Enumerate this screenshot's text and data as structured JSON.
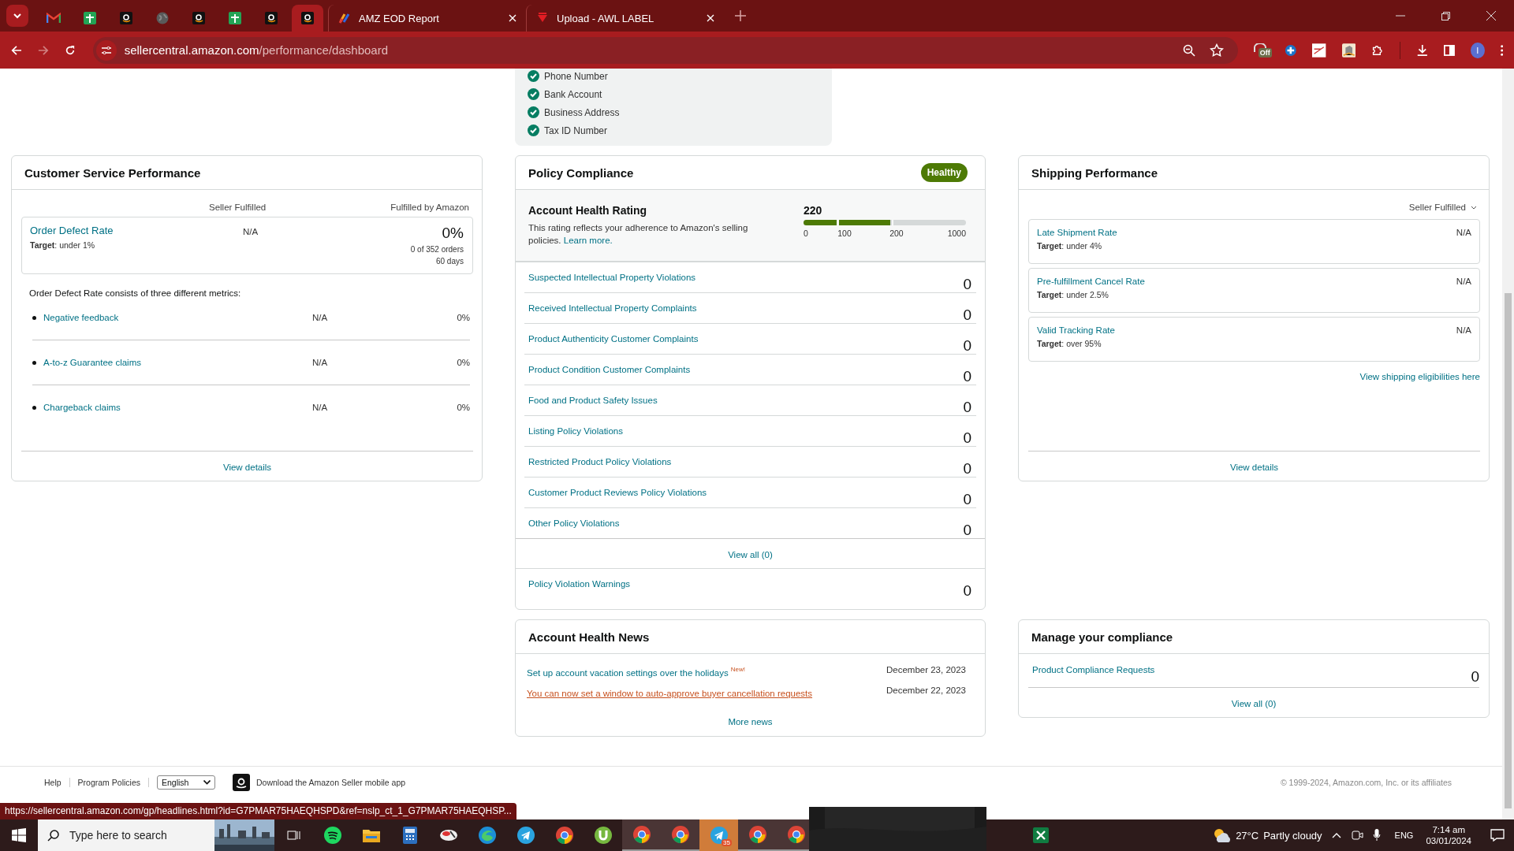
{
  "browser": {
    "pinned_tabs": [
      {
        "selected": false
      },
      {
        "selected": false
      },
      {
        "selected": false
      },
      {
        "selected": false
      },
      {
        "selected": false
      },
      {
        "selected": false
      },
      {
        "selected": false
      },
      {
        "selected": true
      }
    ],
    "tabs": [
      {
        "title": "AMZ EOD Report",
        "selected": false
      },
      {
        "title": "Upload - AWL LABEL",
        "selected": false
      }
    ],
    "url_host": "sellercentral.amazon.com",
    "url_path": "/performance/dashboard",
    "extension_badge": "Off",
    "profile_initial": "I"
  },
  "verification": {
    "items": [
      {
        "label": "Phone Number",
        "verified": true
      },
      {
        "label": "Bank Account",
        "verified": true
      },
      {
        "label": "Business Address",
        "verified": true
      },
      {
        "label": "Tax ID Number",
        "verified": true
      }
    ]
  },
  "customer_service": {
    "title": "Customer Service Performance",
    "columns": [
      "Seller Fulfilled",
      "Fulfilled by Amazon"
    ],
    "odr": {
      "name": "Order Defect Rate",
      "target": "**Target**: under 1%",
      "seller": "N/A",
      "fba": "0%",
      "fba_detail": "0 of 352 orders",
      "period": "60 days"
    },
    "note": "Order Defect Rate consists of three different metrics:",
    "metrics": [
      {
        "name": "Negative feedback",
        "seller": "N/A",
        "fba": "0%"
      },
      {
        "name": "A-to-z Guarantee claims",
        "seller": "N/A",
        "fba": "0%"
      },
      {
        "name": "Chargeback claims",
        "seller": "N/A",
        "fba": "0%"
      }
    ],
    "view": "View details"
  },
  "policy": {
    "title": "Policy Compliance",
    "status": "Healthy",
    "rating": {
      "title": "Account Health Rating",
      "description": "This rating reflects your adherence to Amazon's selling policies.",
      "link": "Learn more.",
      "score": "220",
      "level": 0.535,
      "ticks": [
        "0",
        "100",
        "200",
        "1000"
      ]
    },
    "violations": [
      {
        "label": "Suspected Intellectual Property Violations",
        "count": "0"
      },
      {
        "label": "Received Intellectual Property Complaints",
        "count": "0"
      },
      {
        "label": "Product Authenticity Customer Complaints",
        "count": "0"
      },
      {
        "label": "Product Condition Customer Complaints",
        "count": "0"
      },
      {
        "label": "Food and Product Safety Issues",
        "count": "0"
      },
      {
        "label": "Listing Policy Violations",
        "count": "0"
      },
      {
        "label": "Restricted Product Policy Violations",
        "count": "0"
      },
      {
        "label": "Customer Product Reviews Policy Violations",
        "count": "0"
      },
      {
        "label": "Other Policy Violations",
        "count": "0"
      }
    ],
    "view_all": "View all (0)",
    "warnings": {
      "label": "Policy Violation Warnings",
      "count": "0"
    }
  },
  "news": {
    "title": "Account Health News",
    "items": [
      {
        "text": "Set up account vacation settings over the holidays",
        "badge": "New!",
        "date": "December 23, 2023",
        "hovered": false
      },
      {
        "text": "You can now set a window to auto-approve buyer cancellation requests",
        "date": "December 22, 2023",
        "hovered": true
      }
    ],
    "more": "More news"
  },
  "shipping": {
    "title": "Shipping Performance",
    "filter": "Seller Fulfilled",
    "metrics": [
      {
        "name": "Late Shipment Rate",
        "target": "**Target**: under 4%",
        "value": "N/A"
      },
      {
        "name": "Pre-fulfillment Cancel Rate",
        "target": "**Target**: under 2.5%",
        "value": "N/A"
      },
      {
        "name": "Valid Tracking Rate",
        "target": "**Target**: over 95%",
        "value": "N/A"
      }
    ],
    "link": "View shipping eligibilities here",
    "view": "View details"
  },
  "compliance": {
    "title": "Manage your compliance",
    "items": [
      {
        "label": "Product Compliance Requests",
        "count": "0"
      }
    ],
    "view_all": "View all (0)"
  },
  "footer": {
    "links": [
      "Help",
      "Program Policies"
    ],
    "language": "English",
    "app_text": "Download the Amazon Seller mobile app",
    "copyright": "© 1999-2024, Amazon.com, Inc. or its affiliates"
  },
  "status_url": "https://sellercentral.amazon.com/gp/headlines.html?id=G7PMAR75HAEQHSPD&ref=nslp_ct_1_G7PMAR75HAEQHSP...",
  "taskbar": {
    "search_placeholder": "Type here to search",
    "telegram_badge": "35",
    "temperature": "27°C",
    "weather": "Partly cloudy",
    "language": "ENG",
    "time": "7:14 am",
    "date": "03/01/2024"
  }
}
